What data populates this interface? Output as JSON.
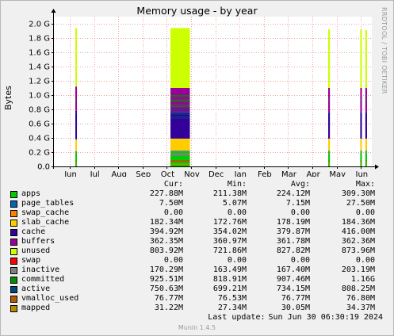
{
  "title": "Memory usage - by year",
  "side_label": "RRDTOOL / TOBI OETIKER",
  "footer": {
    "last_update_label": "Last update:",
    "last_update_value": "Sun Jun 30 06:30:19 2024",
    "version": "Munin 1.4.5"
  },
  "legend": {
    "headers": [
      "Cur:",
      "Min:",
      "Avg:",
      "Max:"
    ],
    "rows": [
      {
        "name": "apps",
        "color": "#00cc00",
        "cur": "227.88M",
        "min": "211.38M",
        "avg": "224.12M",
        "max": "309.30M"
      },
      {
        "name": "page_tables",
        "color": "#0066b3",
        "cur": "7.50M",
        "min": "5.07M",
        "avg": "7.15M",
        "max": "27.50M"
      },
      {
        "name": "swap_cache",
        "color": "#ff8000",
        "cur": "0.00",
        "min": "0.00",
        "avg": "0.00",
        "max": "0.00"
      },
      {
        "name": "slab_cache",
        "color": "#ffcc00",
        "cur": "182.34M",
        "min": "172.76M",
        "avg": "178.19M",
        "max": "184.36M"
      },
      {
        "name": "cache",
        "color": "#330099",
        "cur": "394.92M",
        "min": "354.02M",
        "avg": "379.87M",
        "max": "416.00M"
      },
      {
        "name": "buffers",
        "color": "#990099",
        "cur": "362.35M",
        "min": "360.97M",
        "avg": "361.78M",
        "max": "362.36M"
      },
      {
        "name": "unused",
        "color": "#ccff00",
        "cur": "803.92M",
        "min": "721.86M",
        "avg": "827.82M",
        "max": "873.96M"
      },
      {
        "name": "swap",
        "color": "#ff0000",
        "cur": "0.00",
        "min": "0.00",
        "avg": "0.00",
        "max": "0.00"
      },
      {
        "name": "inactive",
        "color": "#808080",
        "cur": "170.29M",
        "min": "163.49M",
        "avg": "167.40M",
        "max": "203.19M"
      },
      {
        "name": "committed",
        "color": "#008f00",
        "cur": "925.51M",
        "min": "818.91M",
        "avg": "907.46M",
        "max": "1.16G"
      },
      {
        "name": "active",
        "color": "#00487d",
        "cur": "750.63M",
        "min": "699.21M",
        "avg": "734.15M",
        "max": "808.25M"
      },
      {
        "name": "vmalloc_used",
        "color": "#b35a00",
        "cur": "76.77M",
        "min": "76.53M",
        "avg": "76.77M",
        "max": "76.80M"
      },
      {
        "name": "mapped",
        "color": "#b38f00",
        "cur": "31.22M",
        "min": "27.34M",
        "avg": "30.05M",
        "max": "34.37M"
      }
    ]
  },
  "chart_data": {
    "type": "area",
    "title": "Memory usage - by year",
    "ylabel": "Bytes",
    "ylim": [
      0,
      2.1
    ],
    "y_unit": "G",
    "yticks": [
      0.0,
      0.2,
      0.4,
      0.6,
      0.8,
      1.0,
      1.2,
      1.4,
      1.6,
      1.8,
      2.0
    ],
    "ytick_labels": [
      "0.0",
      "0.2 G",
      "0.4 G",
      "0.6 G",
      "0.8 G",
      "1.0 G",
      "1.2 G",
      "1.4 G",
      "1.6 G",
      "1.8 G",
      "2.0 G"
    ],
    "xticks": [
      "Jun",
      "Jul",
      "Aug",
      "Sep",
      "Oct",
      "Nov",
      "Dec",
      "Jan",
      "Feb",
      "Mar",
      "Apr",
      "May",
      "Jun"
    ],
    "grid": true,
    "stack_order": [
      "apps",
      "page_tables",
      "swap_cache",
      "slab_cache",
      "cache",
      "buffers",
      "unused",
      "swap"
    ],
    "segments": [
      {
        "start_month": 0.23,
        "end_month": 0.28,
        "values": {
          "apps": 0.2,
          "page_tables": 0.01,
          "swap_cache": 0,
          "slab_cache": 0.17,
          "cache": 0.4,
          "buffers": 0.34,
          "unused": 0.82,
          "swap": 0
        }
      },
      {
        "start_month": 4.15,
        "end_month": 4.95,
        "values": {
          "apps": 0.21,
          "page_tables": 0.01,
          "swap_cache": 0,
          "slab_cache": 0.17,
          "cache": 0.37,
          "buffers": 0.34,
          "unused": 0.84,
          "swap": 0
        }
      },
      {
        "start_month": 10.65,
        "end_month": 10.72,
        "values": {
          "apps": 0.21,
          "page_tables": 0.01,
          "swap_cache": 0,
          "slab_cache": 0.17,
          "cache": 0.37,
          "buffers": 0.34,
          "unused": 0.82,
          "swap": 0
        }
      },
      {
        "start_month": 11.97,
        "end_month": 12.04,
        "values": {
          "apps": 0.21,
          "page_tables": 0.01,
          "swap_cache": 0,
          "slab_cache": 0.17,
          "cache": 0.37,
          "buffers": 0.34,
          "unused": 0.82,
          "swap": 0
        }
      },
      {
        "start_month": 12.18,
        "end_month": 12.25,
        "values": {
          "apps": 0.21,
          "page_tables": 0.01,
          "swap_cache": 0,
          "slab_cache": 0.17,
          "cache": 0.37,
          "buffers": 0.34,
          "unused": 0.81,
          "swap": 0
        }
      }
    ],
    "line_series": [
      {
        "name": "inactive",
        "value": 0.17
      },
      {
        "name": "committed",
        "value": 0.93
      },
      {
        "name": "active",
        "value": 0.75
      },
      {
        "name": "vmalloc_used",
        "value": 0.077
      },
      {
        "name": "mapped",
        "value": 0.031
      }
    ]
  }
}
